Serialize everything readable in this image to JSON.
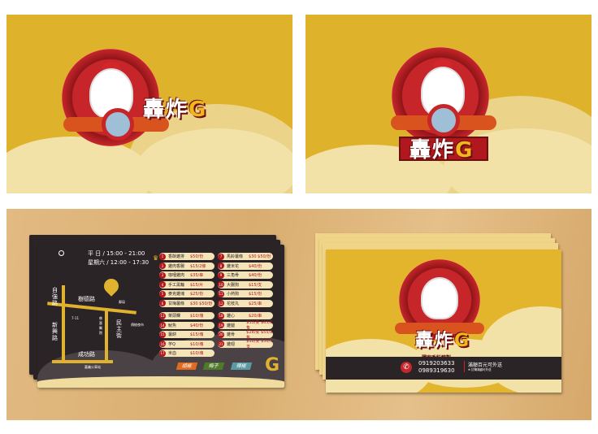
{
  "logo": {
    "text": "轟炸",
    "letter": "G"
  },
  "front": {
    "tagline": "獨家香料醃製",
    "phones": [
      "0919203633",
      "0989319630"
    ],
    "delivery": "滿額百元可外送",
    "delivery_note": "※ 訂購滿額可外送"
  },
  "hours": [
    "平 日 / 15:00 - 21:00",
    "星期六 / 12:00 - 17:30"
  ],
  "map": {
    "roads": {
      "r1": "自強路",
      "r2": "樹德路",
      "r3": "新興路",
      "r4": "民主街",
      "r5": "成功路"
    },
    "landmarks": {
      "l1": "7-11",
      "l2": "郵局",
      "l3": "傳統夜市",
      "l4": "慈惠醫院",
      "l5": "嘉義火車站"
    }
  },
  "menu": [
    {
      "n": "1",
      "name": "香酥雞排",
      "price": "$50/份"
    },
    {
      "n": "2",
      "name": "雞肉香腸",
      "price": "$15/2條"
    },
    {
      "n": "3",
      "name": "咖哩雞肉",
      "price": "$35/串"
    },
    {
      "n": "4",
      "name": "手工黑輪",
      "price": "$15/片"
    },
    {
      "n": "5",
      "name": "麥克雞塊",
      "price": "$25/份"
    },
    {
      "n": "6",
      "name": "甘梅薯條",
      "price": "$30 $50/份"
    },
    {
      "n": "7",
      "name": "馬鈴薯條",
      "price": "$30 $50/份"
    },
    {
      "n": "8",
      "name": "雞米花",
      "price": "$40/份"
    },
    {
      "n": "9",
      "name": "三角骨",
      "price": "$40/份"
    },
    {
      "n": "10",
      "name": "大腸狗",
      "price": "$15/支"
    },
    {
      "n": "11",
      "name": "小熱狗",
      "price": "$15/份"
    },
    {
      "n": "12",
      "name": "花枝丸",
      "price": "$25/串"
    },
    {
      "n": "13",
      "name": "菜頭粿",
      "price": "$10/塊"
    },
    {
      "n": "14",
      "name": "魷魚",
      "price": "$40/份"
    },
    {
      "n": "15",
      "name": "薯餅",
      "price": "$15/塊"
    },
    {
      "n": "16",
      "name": "芋Q",
      "price": "$10/塊"
    },
    {
      "n": "17",
      "name": "米血",
      "price": "$10/塊"
    },
    {
      "n": "18",
      "name": "雞心",
      "price": "$20/串"
    },
    {
      "n": "19",
      "name": "雞腿",
      "price": "$33/隻 $65/2隻"
    },
    {
      "n": "20",
      "name": "雞骨",
      "price": "$28/隻 $55/2隻"
    },
    {
      "n": "21",
      "name": "雞翅",
      "price": "$18/隻 $50/3支"
    }
  ],
  "flavors": [
    {
      "label": "胡椒",
      "color": "#e06a1e"
    },
    {
      "label": "梅子",
      "color": "#4e7a2a"
    },
    {
      "label": "辣椒",
      "color": "#5a9aa5"
    }
  ]
}
